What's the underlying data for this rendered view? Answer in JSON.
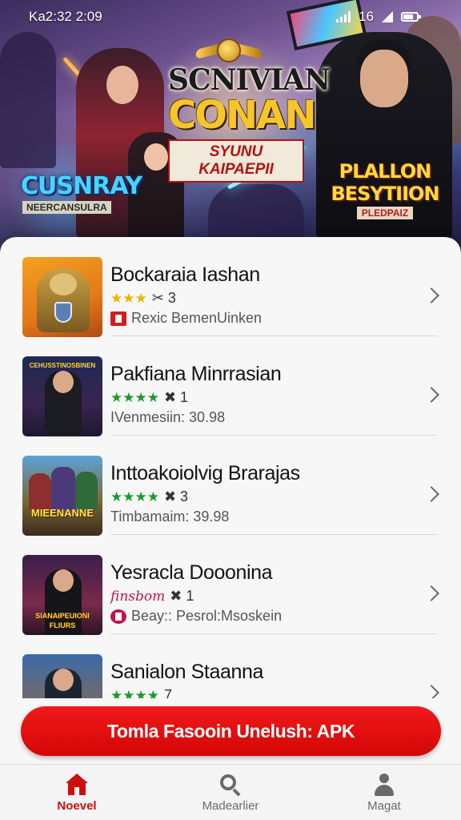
{
  "status_bar": {
    "time": "Ka2:32 2:09",
    "right_text": "16"
  },
  "banner": {
    "title_line1": "SCNIVIAN",
    "title_line2": "CONAN",
    "subtitle": "SYUNU KAIPAEPII",
    "left_logo": "CUSNRAY",
    "left_logo_sub": "NEERCANSULRA",
    "right_logo": "PLALLON BESYTIION",
    "right_logo_sub": "PLEDPAIZ"
  },
  "apps": [
    {
      "name": "Bockaraia Iashan",
      "stars": "★★★",
      "rating_suffix": "✂ 3",
      "detail": "Rexic BemenUinken",
      "star_color": "#e8b400",
      "detail_icon": "tag-icon",
      "thumb_text": ""
    },
    {
      "name": "Pakfiana Minrrasian",
      "stars": "★★★★",
      "rating_suffix": "✖ 1",
      "detail": "IVenmesiin: 30.98",
      "star_color": "#1a9a2a",
      "detail_icon": "",
      "thumb_text": "CEHUSSTINOSBINEN"
    },
    {
      "name": "Inttoakoiolvig Brarajas",
      "stars": "★★★★",
      "rating_suffix": "✖ 3",
      "detail": "Timbamaim: 39.98",
      "star_color": "#1a9a2a",
      "detail_icon": "",
      "thumb_text": "MIEENANNE"
    },
    {
      "name": "Yesracla Dooonina",
      "stars": "finsbom",
      "rating_suffix": "✖ 1",
      "detail": "Beay:: Pesrol:Msoskein",
      "star_color": "#c0164b",
      "detail_icon": "ticket-icon",
      "thumb_text": "SIANAIPEUIONI FLIURS"
    },
    {
      "name": "Sanialon Staanna",
      "stars": "★★★★",
      "rating_suffix": "7",
      "detail": "",
      "star_color": "#1a9a2a",
      "detail_icon": "",
      "thumb_text": ""
    }
  ],
  "cta": {
    "label": "Tomla Fasooin Unelush: APK"
  },
  "bottom_nav": [
    {
      "label": "Noevel",
      "icon": "home-icon",
      "active": true
    },
    {
      "label": "Madearlier",
      "icon": "search-icon",
      "active": false
    },
    {
      "label": "Magat",
      "icon": "user-icon",
      "active": false
    }
  ],
  "colors": {
    "accent_red": "#d40606",
    "star_gold": "#e8b400",
    "star_green": "#1a9a2a"
  }
}
